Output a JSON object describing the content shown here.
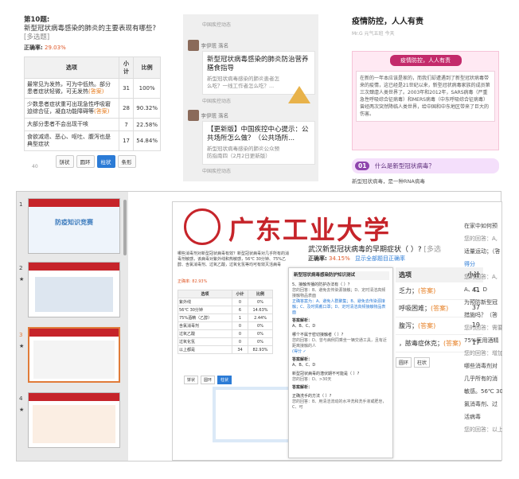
{
  "p1": {
    "qnum": "第10题:",
    "question": "新型冠状病毒感染的肺炎的主要表现有哪些?",
    "qtype": "[多选题]",
    "rate_label": "正确率:",
    "rate": "29.03%",
    "headers": [
      "选项",
      "小计",
      "比例"
    ],
    "rows": [
      {
        "opt": "最常见为发热，可为中低热。部分患者症状轻微，可无发热",
        "ans": "(答案)",
        "count": "31",
        "pct": "100%"
      },
      {
        "opt": "少数患者症状重可出现急性呼吸窘迫综合征，凝血功能障碍等",
        "ans": "(答案)",
        "count": "28",
        "pct": "90.32%"
      },
      {
        "opt": "大部分患者不会出现干咳",
        "ans": "",
        "count": "7",
        "pct": "22.58%"
      },
      {
        "opt": "食欲减退、恶心、呕吐、腹泻也是典型症状",
        "ans": "",
        "count": "17",
        "pct": "54.84%"
      }
    ],
    "buttons": [
      "饼状",
      "圆环",
      "柱状",
      "条形"
    ],
    "axis_tick": "40"
  },
  "p2": {
    "top_source": "中国疾控动态",
    "user1": "李伊珉 落名",
    "card1_title": "新型冠状病毒感染的肺炎防治营养膳食指导",
    "card1_sub": "新型冠状病毒感染的肺炎患者怎么吃？一线工作者怎么吃？...",
    "source1": "中国疾控动态",
    "user2": "李伊珉 落名",
    "card2_title": "【更新版】中国疾控中心提示：公共场所怎么做？（公共场所...",
    "card2_sub": "新型冠状病毒感染的肺炎公众预防指南四（2月2日更新版）",
    "source2": "中国疾控动态"
  },
  "p3": {
    "title": "疫情防控，人人有责",
    "meta": "Mr.G  元气五班  今天",
    "banner_title": "疫情防控，人人有责",
    "banner_text": "在新的一年本应该是家的，而我们却遭遇到了新型冠状病毒带来的疫情，这已经是21世纪以来，新型冠状病毒家族的成员第三次肆虐人类世界了。2003年和2012年，SARS病毒（严重急性呼吸综合征病毒）和MERS病毒（中东呼吸综合征病毒）曾经两次突然降临人类世界，给中国和中东地区带来了巨大的伤害。",
    "sec_num": "01",
    "sec_title": "什么是新型冠状病毒？",
    "sec_text": "新型冠状病毒，是一种RNA病毒"
  },
  "p4": {
    "thumb_nums": [
      "1",
      "2",
      "3",
      "4"
    ],
    "thumb1_title": "防疫知识竞赛",
    "brand": "广东工业大学",
    "slide_q": "武汉新型冠状病毒的早期症状（ ）?",
    "slide_qtype": "[多选",
    "slide_rate_label": "正确率:",
    "slide_rate": "34.15%",
    "slide_link": "显示全部题目正确率",
    "slide_table_header": "选项",
    "slide_table_header2": "小计",
    "slide_rows": [
      {
        "opt": "乏力；",
        "ans": "(答案)",
        "count": "41"
      },
      {
        "opt": "呼吸困难；",
        "ans": "(答案)",
        "count": "37"
      },
      {
        "opt": "腹泻；",
        "ans": "(答案)",
        "count": "19"
      },
      {
        "opt": "，脓毒症休克；",
        "ans": "(答案)",
        "count": "17"
      }
    ],
    "slide_buttons": [
      "饼状",
      "圆环",
      "柱状"
    ],
    "right_col": [
      "在家中如何预",
      "您的回答：A,",
      "适量运动；（答",
      "得分",
      "您的回答：A,",
      "A、C、D",
      "为预防新型冠",
      "措施吗？（答",
      "您的回答：需要",
      "75%医用酒精",
      "您的回答：增加",
      "哪些消毒剂对",
      "几乎所有的消",
      "敏感。56℃ 30",
      "氯消毒剂、过",
      "活病毒",
      "您的回答：以上"
    ],
    "left_block_text": "哪些消毒剂对新型冠状病毒有效？新型冠状病毒对几乎所有的消毒剂敏感，该病毒对紫外线和热敏感，56℃ 30分钟、75%乙醇、含氯消毒剂、过氧乙酸，过氧化氢等均可有效灭活病毒",
    "left_rate": "正确率: 82.93%",
    "left_table_header": [
      "选项",
      "小计",
      "比例"
    ],
    "left_table_rows": [
      [
        "紫外线",
        "0",
        "0%"
      ],
      [
        "56℃ 30分钟",
        "6",
        "14.63%"
      ],
      [
        "75%酒精（乙醇）",
        "1",
        "2.44%"
      ],
      [
        "含氯消毒剂",
        "0",
        "0%"
      ],
      [
        "过氧乙酸",
        "0",
        "0%"
      ],
      [
        "过氧化氢",
        "0",
        "0%"
      ],
      [
        "以上都是",
        "34",
        "82.93%"
      ]
    ],
    "quiz_title": "新型冠状病毒感染防护知识测试",
    "quiz_items": [
      "5、接触传播的防护办法有（ ）？",
      "您的回答：B、避免去传染源接触；D、定时清洁高频接触物品表面",
      "正确答案为：A、避免人群聚集；B、避免去传染源接触；C、及时佩戴口罩；D、定时清洁高频接触物品表面",
      "答案解析：",
      "A、B、C、D",
      "哪个不属于密切接触者（ ）?",
      "您的回答：D、曾与病例同乘坐一辆交通工具，且有近距离接触的人",
      "答案解析：",
      "A、B、C、D",
      "新型冠状病毒的潜伏期不可能是（ ）?",
      "您的回答：D、>30天",
      "答案解析：",
      "正确洗手的方法（ ）?",
      "您的回答：B、用清洁流动的水冲洗和洗手液或肥皂，C、可"
    ],
    "quiz_score": "分值",
    "quiz_got": "(得分",
    "quiz_tick": "✓"
  }
}
